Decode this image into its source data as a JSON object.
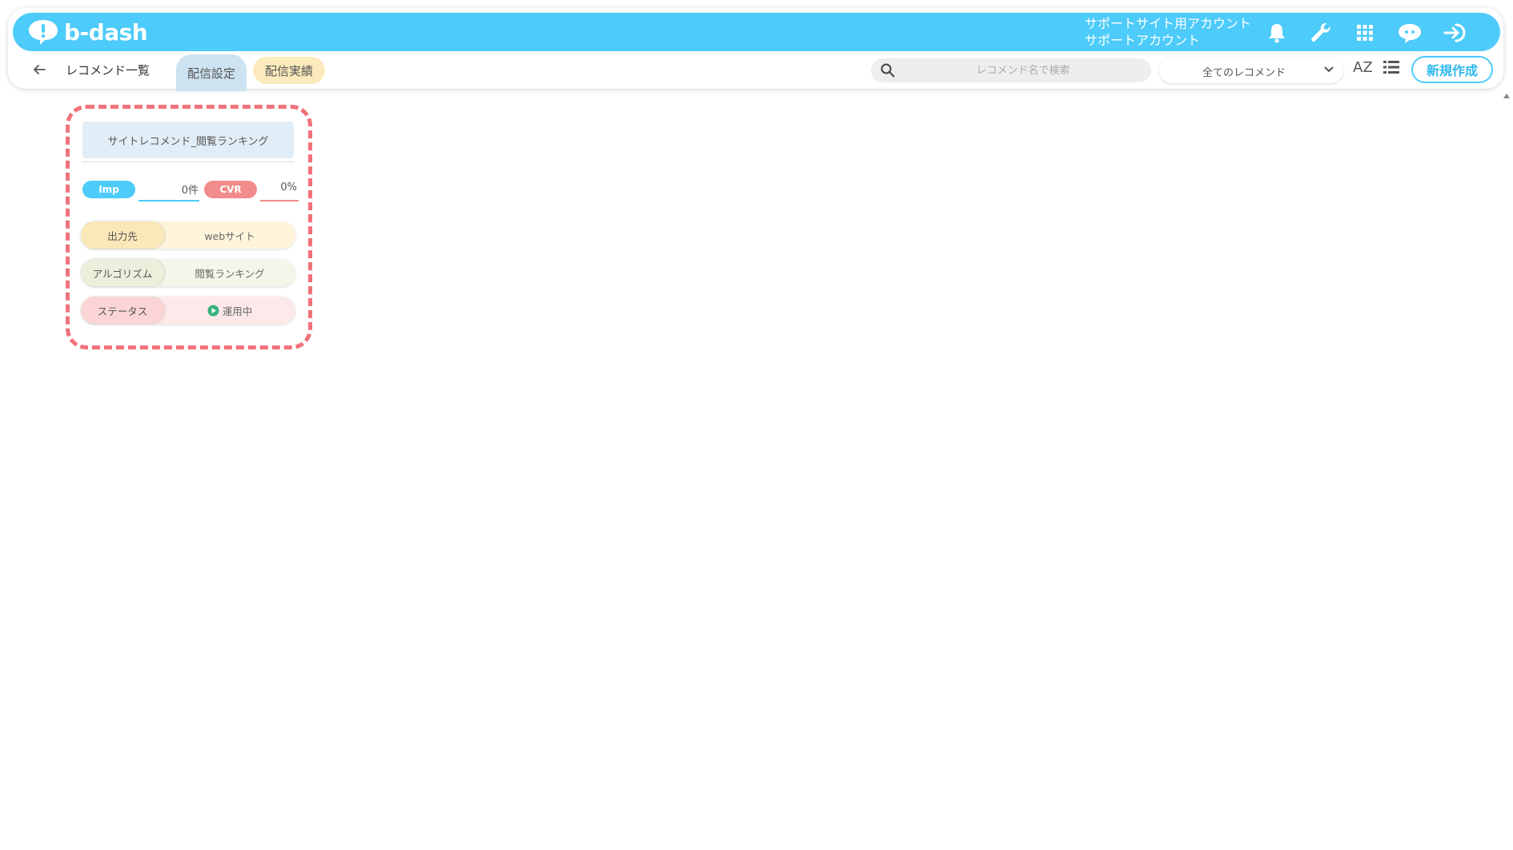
{
  "header": {
    "logo_text": "b-dash",
    "account_line1": "サポートサイト用アカウント",
    "account_line2": "サポートアカウント",
    "icons": [
      "bell-icon",
      "wrench-icon",
      "apps-grid-icon",
      "chatbot-icon",
      "logout-icon"
    ]
  },
  "subbar": {
    "breadcrumb": "レコメンド一覧",
    "tabs": [
      {
        "label": "配信設定",
        "active": true
      },
      {
        "label": "配信実績",
        "active": false
      }
    ],
    "search_placeholder": "レコメンド名で検索",
    "filter_selected": "全てのレコメンド",
    "sort_label": "AZ",
    "new_button": "新規作成"
  },
  "card": {
    "title": "サイトレコメンド_閲覧ランキング",
    "imp_label": "Imp",
    "imp_value": "0件",
    "cvr_label": "CVR",
    "cvr_value": "0%",
    "rows": [
      {
        "label": "出力先",
        "value": "webサイト",
        "color": "#fff5dc",
        "label_color": "#fbe8b8"
      },
      {
        "label": "アルゴリズム",
        "value": "閲覧ランキング",
        "color": "#f5f5ea",
        "label_color": "#ecefdb"
      },
      {
        "label": "ステータス",
        "value": "運用中",
        "color": "#fde9e9",
        "label_color": "#fbd5d5",
        "status_icon": "play-circle-icon"
      }
    ]
  },
  "colors": {
    "brand": "#4dcbfa",
    "imp": "#4dcbfa",
    "cvr": "#f28b8b",
    "highlight": "#f0727a",
    "status_running": "#36b37e"
  }
}
